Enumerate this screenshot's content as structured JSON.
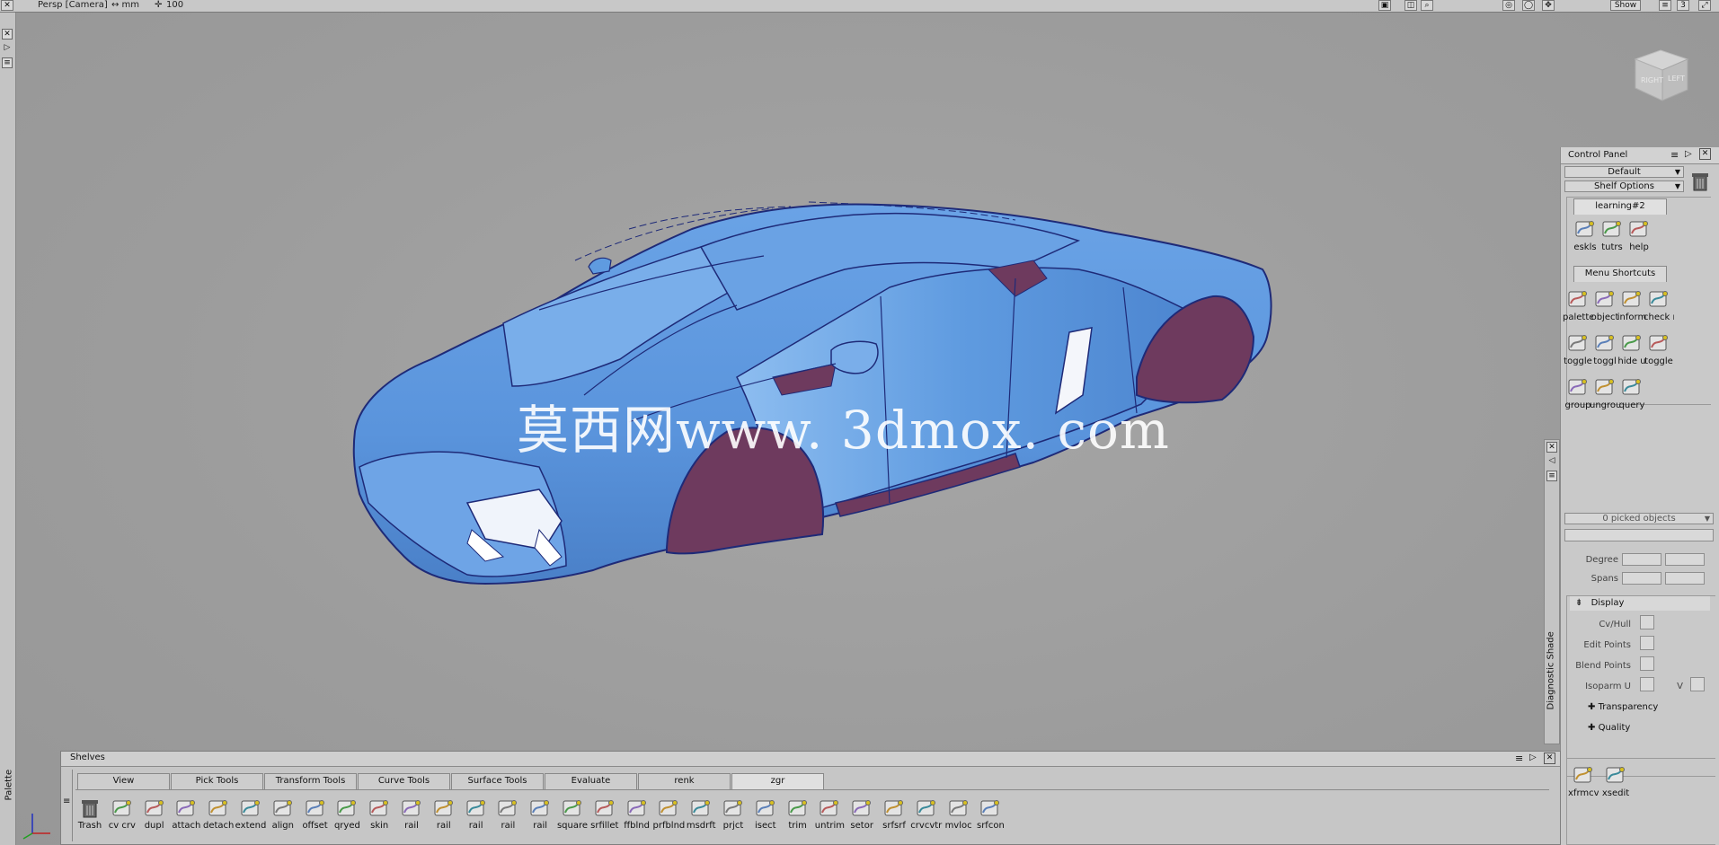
{
  "topbar": {
    "camera_label": "Persp [Camera]",
    "units": "↔ mm",
    "zoom": "100",
    "show_label": "Show",
    "pane_count": "3"
  },
  "left_strip": {
    "palette_label": "Palette"
  },
  "view_cube": {
    "face_right": "RIGHT",
    "face_left": "LEFT"
  },
  "watermark": "莫西网www. 3dmox. com",
  "control_panel": {
    "title": "Control Panel",
    "layout_dropdown": "Default",
    "shelf_options": "Shelf Options",
    "learning_tab": "learning#2",
    "learning_icons": [
      {
        "label": "eskls",
        "icon": "skills-icon"
      },
      {
        "label": "tutrs",
        "icon": "tutorials-icon"
      },
      {
        "label": "help",
        "icon": "help-icon"
      }
    ],
    "shortcuts_tab": "Menu Shortcuts",
    "shortcut_icons": [
      {
        "label": "palette",
        "icon": "palette-icon"
      },
      {
        "label": "object",
        "icon": "object-icon"
      },
      {
        "label": "inform",
        "icon": "information-icon"
      },
      {
        "label": "check r",
        "icon": "check-icon"
      },
      {
        "label": "toggle",
        "icon": "toggle-icon"
      },
      {
        "label": "toggl",
        "icon": "toggle-icon"
      },
      {
        "label": "hide u",
        "icon": "hide-icon"
      },
      {
        "label": "toggle",
        "icon": "toggle-icon"
      },
      {
        "label": "group",
        "icon": "group-icon"
      },
      {
        "label": "ungroup",
        "icon": "ungroup-icon"
      },
      {
        "label": "query",
        "icon": "query-icon"
      }
    ],
    "picked_objects": "0 picked objects",
    "degree_label": "Degree",
    "spans_label": "Spans",
    "display_label": "Display",
    "cvhull_label": "Cv/Hull",
    "edit_points_label": "Edit Points",
    "blend_points_label": "Blend Points",
    "isoparm_u_label": "Isoparm U",
    "v_label": "V",
    "transparency_label": "Transparency",
    "quality_label": "Quality",
    "bottom_icons": [
      {
        "label": "xfrmcv",
        "icon": "transform-cv-icon"
      },
      {
        "label": "xsedit",
        "icon": "xsedit-icon"
      }
    ]
  },
  "diagnostic": {
    "label": "Diagnostic Shade"
  },
  "shelves": {
    "title": "Shelves",
    "tabs": [
      "View",
      "Pick Tools",
      "Transform Tools",
      "Curve Tools",
      "Surface Tools",
      "Evaluate",
      "renk",
      "zgr"
    ],
    "active_tab": "zgr",
    "tools": [
      "Trash",
      "cv crv",
      "dupl",
      "attach",
      "detach",
      "extend",
      "align",
      "offset",
      "qryed",
      "skin",
      "rail",
      "rail",
      "rail",
      "rail",
      "rail",
      "square",
      "srfillet",
      "ffblnd",
      "prfblnd",
      "msdrft",
      "prjct",
      "isect",
      "trim",
      "untrim",
      "setor",
      "srfsrf",
      "crvcvtr",
      "mvloc",
      "srfcon"
    ]
  },
  "colors": {
    "car_body": "#5f9be0",
    "car_edge": "#1e2a78",
    "wheel_arch": "#6e3a5e",
    "viewport_bg": "#a0a0a0",
    "panel_bg": "#c9c9c9"
  }
}
